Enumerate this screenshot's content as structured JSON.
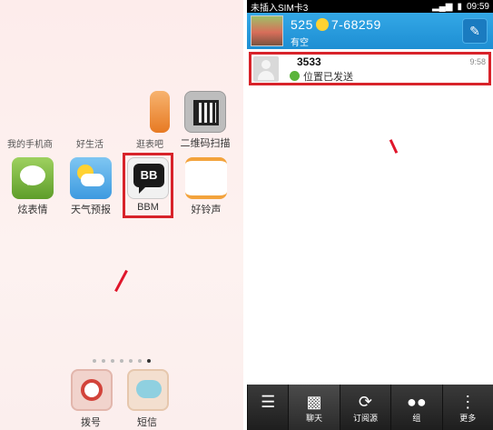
{
  "left": {
    "partial_labels": [
      "我的手机商",
      "好生活",
      "逛表吧",
      "二维码扫描"
    ],
    "apps": [
      {
        "name": "炫表情"
      },
      {
        "name": "天气预报"
      },
      {
        "name": "BBM"
      },
      {
        "name": "好铃声"
      }
    ],
    "bbm_badge": "BB",
    "dock": [
      {
        "name": "拨号"
      },
      {
        "name": "短信"
      }
    ]
  },
  "right": {
    "status": {
      "carrier": "未插入SIM卡3",
      "time": "09:59"
    },
    "contact": {
      "name": "525",
      "name_tail": "7-68259",
      "status": "有空"
    },
    "chat": {
      "name": "3533",
      "message": "位置已发送",
      "time": "9:58"
    },
    "tabs": [
      {
        "label": "",
        "icon": "menu-icon"
      },
      {
        "label": "聊天",
        "icon": "chat-icon"
      },
      {
        "label": "订阅源",
        "icon": "refresh-icon"
      },
      {
        "label": "组",
        "icon": "group-icon"
      },
      {
        "label": "更多",
        "icon": "more-icon"
      }
    ]
  },
  "colors": {
    "highlight": "#d8232a",
    "header": "#1d8ed3",
    "online": "#5ab43a"
  }
}
